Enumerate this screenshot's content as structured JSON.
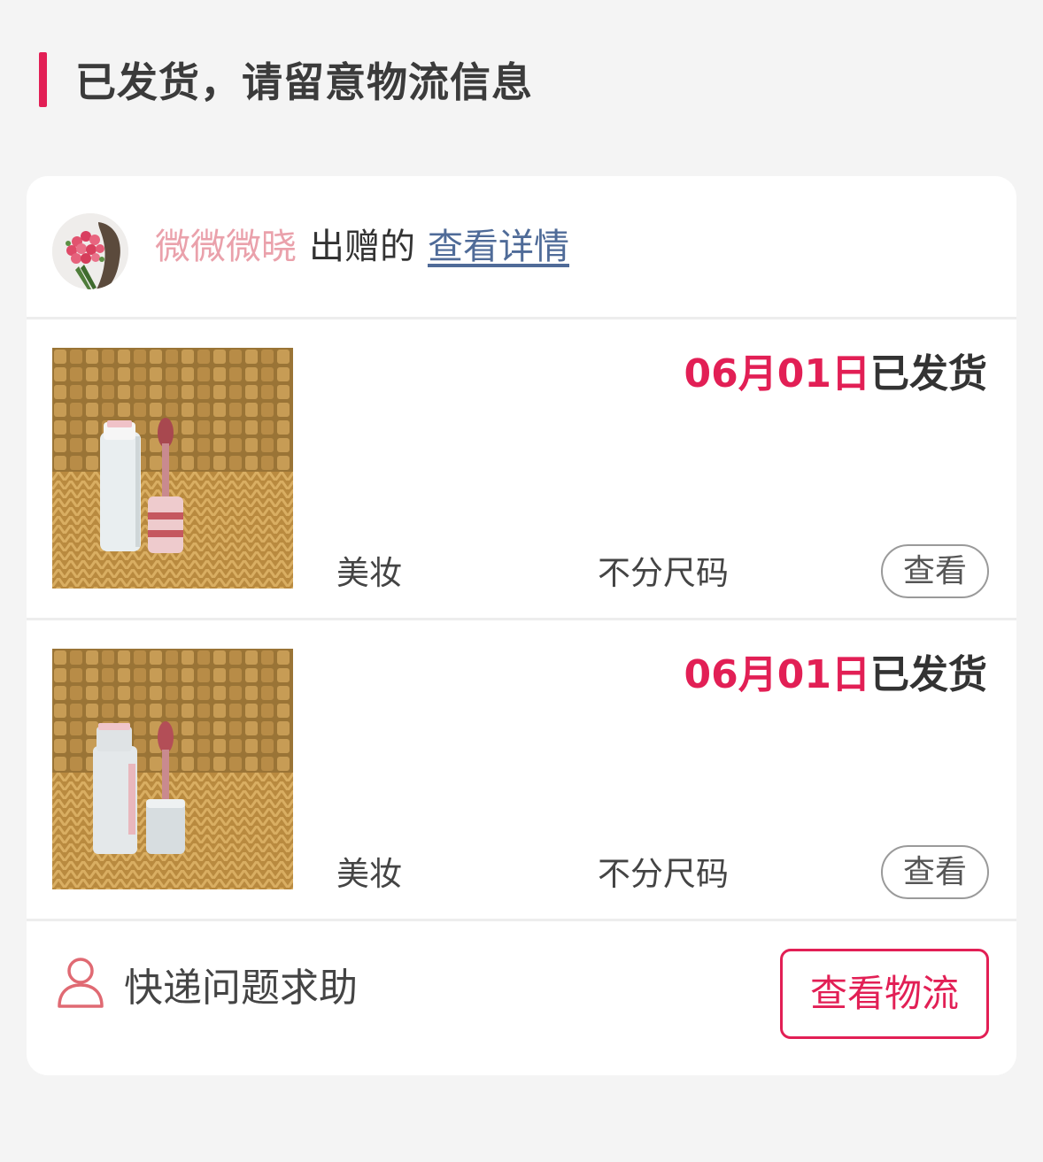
{
  "header": {
    "title": "已发货，请留意物流信息"
  },
  "giver": {
    "name": "微微微晓",
    "verb": "出赠的",
    "link": "查看详情"
  },
  "items": [
    {
      "date": "06月01日",
      "status": "已发货",
      "category": "美妆",
      "size": "不分尺码",
      "view_label": "查看"
    },
    {
      "date": "06月01日",
      "status": "已发货",
      "category": "美妆",
      "size": "不分尺码",
      "view_label": "查看"
    }
  ],
  "footer": {
    "help_label": "快递问题求助",
    "logistics_button": "查看物流"
  },
  "colors": {
    "accent": "#e21f55",
    "giver_name": "#eaa1ab",
    "link": "#4f6b98"
  },
  "icons": {
    "help": "user-icon"
  }
}
